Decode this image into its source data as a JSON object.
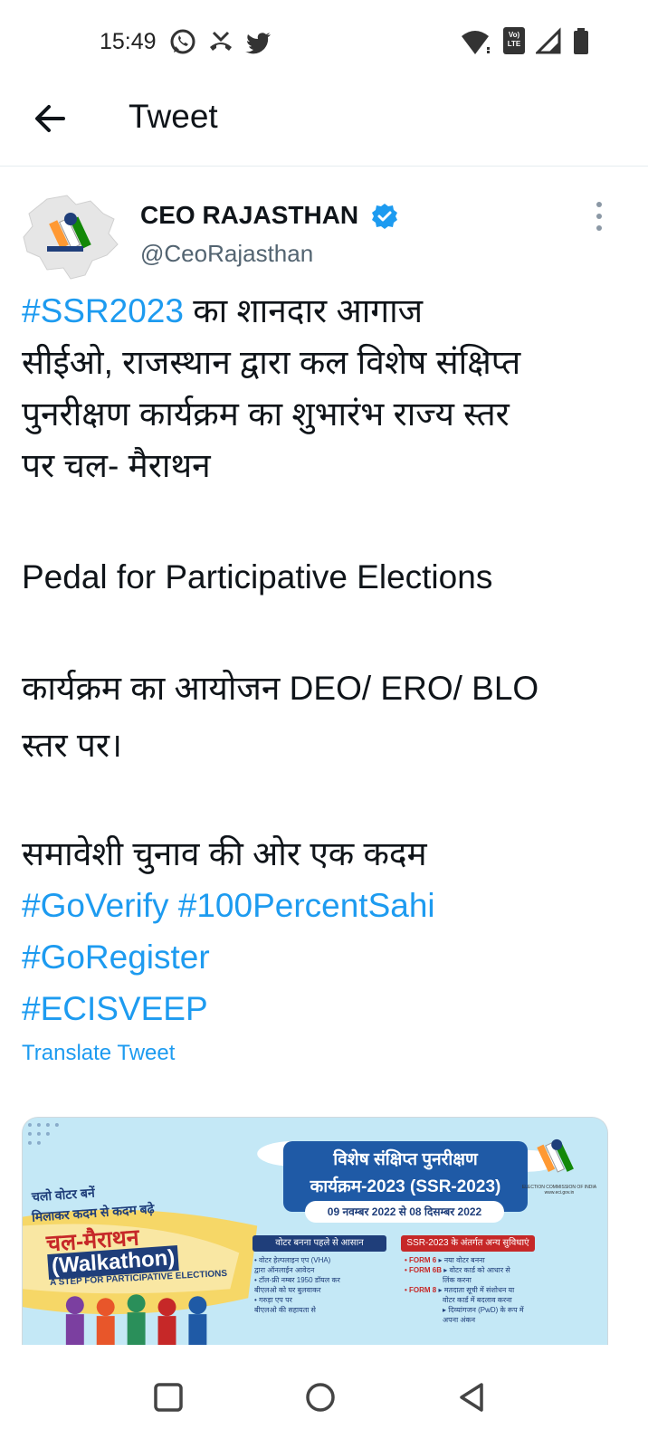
{
  "status_bar": {
    "time": "15:49",
    "left_icons": [
      "whatsapp-icon",
      "missed-call-icon",
      "twitter-icon"
    ],
    "right_icons": [
      "wifi-icon",
      "volte-icon",
      "signal-icon",
      "battery-icon"
    ],
    "volte_text": "Vo) LTE"
  },
  "header": {
    "title": "Tweet",
    "back_icon": "arrow-left-icon"
  },
  "tweet": {
    "author_name": "CEO RAJASTHAN",
    "handle": "@CeoRajasthan",
    "verified": true,
    "text": {
      "hashtag_ssr": "#SSR2023",
      "l1_rest": " का शानदार आगाज",
      "l2": "सीईओ, राजस्थान द्वारा कल विशेष संक्षिप्त",
      "l3": "पुनरीक्षण कार्यक्रम का शुभारंभ राज्य स्तर",
      "l4": "पर चल- मैराथन",
      "l5": "Pedal for Participative Elections",
      "l6": "कार्यक्रम का आयोजन DEO/ ERO/ BLO",
      "l7": "स्तर पर।",
      "l8": "समावेशी चुनाव की ओर एक कदम",
      "hashtag_goverify": "#GoVerify",
      "hashtag_100": "#100PercentSahi",
      "hashtag_goregister": "#GoRegister",
      "hashtag_ecisveep": "#ECISVEEP"
    },
    "translate_label": "Translate Tweet",
    "link_color": "#1d9bf0"
  },
  "media": {
    "title_line1": "विशेष संक्षिप्त पुनरीक्षण",
    "title_line2": "कार्यक्रम-2023 (SSR-2023)",
    "dates": "09 नवम्बर 2022 से 08 दिसम्बर 2022",
    "eci_text": "ELECTION COMMISSION OF INDIA www.eci.gov.in",
    "slogan_line1": "चलो वोटर बनें",
    "slogan_line2": "मिलाकर कदम से कदम बढ़े",
    "walkathon_hindi": "चल-मैराथन",
    "walkathon_english": "(Walkathon)",
    "step_text": "A STEP FOR PARTICIPATIVE ELECTIONS",
    "left_section_title": "वोटर बनना पहले से आसान",
    "left_items": [
      "• वोटर हेल्पलाइन एप (VHA)",
      "  द्वारा ऑनलाईन आवेदन",
      "• टॉल-फ्री नम्बर 1950 डॉयल कर",
      "  बीएलओ को घर बुलवाकर",
      "• गरुड़ा एप पर",
      "  बीएलओ की सहायता से"
    ],
    "right_section_title": "SSR-2023 के अंतर्गत अन्य सुविधाएं",
    "right_items": [
      {
        "form": "• FORM 6",
        "text": "▸ नया वोटर बनना"
      },
      {
        "form": "• FORM 6B",
        "text": "▸ वोटर कार्ड को आधार से"
      },
      {
        "form": "",
        "text": "  लिंक करना"
      },
      {
        "form": "• FORM 8",
        "text": "▸ मतदाता सूची में संशोधन या"
      },
      {
        "form": "",
        "text": "  वोटर कार्ड में बदलाव करना"
      },
      {
        "form": "",
        "text": "▸ दिव्यांगजन (PwD) के रूप में"
      },
      {
        "form": "",
        "text": "  अपना अंकन"
      }
    ]
  },
  "nav_bar": {
    "icons": [
      "recents-square-icon",
      "home-circle-icon",
      "back-triangle-icon"
    ]
  }
}
